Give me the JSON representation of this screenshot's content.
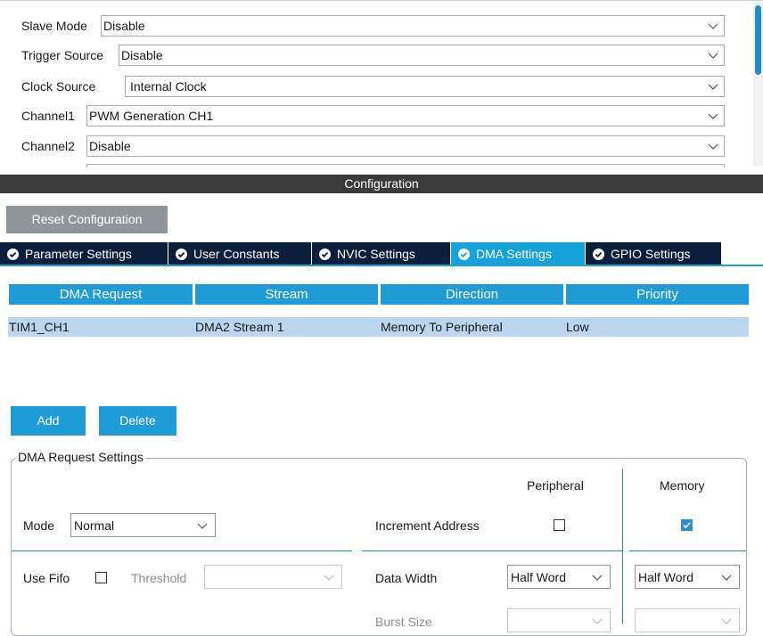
{
  "mode": {
    "slave_mode_label": "Slave Mode",
    "slave_mode_value": "Disable",
    "trigger_source_label": "Trigger Source",
    "trigger_source_value": "Disable",
    "clock_source_label": "Clock Source",
    "clock_source_value": "Internal Clock",
    "channel1_label": "Channel1",
    "channel1_value": "PWM Generation CH1",
    "channel2_label": "Channel2",
    "channel2_value": "Disable"
  },
  "configuration": {
    "title": "Configuration",
    "reset_label": "Reset Configuration"
  },
  "tabs": [
    {
      "label": "Parameter Settings",
      "active": false
    },
    {
      "label": "User Constants",
      "active": false
    },
    {
      "label": "NVIC Settings",
      "active": false
    },
    {
      "label": "DMA Settings",
      "active": true
    },
    {
      "label": "GPIO Settings",
      "active": false
    }
  ],
  "dma_table": {
    "headers": [
      "DMA Request",
      "Stream",
      "Direction",
      "Priority"
    ],
    "rows": [
      [
        "TIM1_CH1",
        "DMA2 Stream 1",
        "Memory To Peripheral",
        "Low"
      ]
    ]
  },
  "actions": {
    "add_label": "Add",
    "delete_label": "Delete"
  },
  "request_settings": {
    "legend": "DMA Request Settings",
    "peripheral_header": "Peripheral",
    "memory_header": "Memory",
    "mode_label": "Mode",
    "mode_value": "Normal",
    "increment_address_label": "Increment Address",
    "increment_peripheral_checked": false,
    "increment_memory_checked": true,
    "use_fifo_label": "Use Fifo",
    "use_fifo_checked": false,
    "threshold_label": "Threshold",
    "threshold_value": "",
    "data_width_label": "Data Width",
    "data_width_peripheral": "Half Word",
    "data_width_memory": "Half Word",
    "burst_size_label": "Burst Size"
  },
  "colors": {
    "accent": "#1f9bd8",
    "tab_dark": "#0b1e3b",
    "selected_row": "#bcd6ee",
    "header_bar": "#3b3b3b",
    "reset_button": "#8f959b"
  },
  "icons": {
    "dropdown": "chevron-down-icon",
    "tab_status": "check-circle-icon",
    "checkbox_checked": "check-icon"
  }
}
